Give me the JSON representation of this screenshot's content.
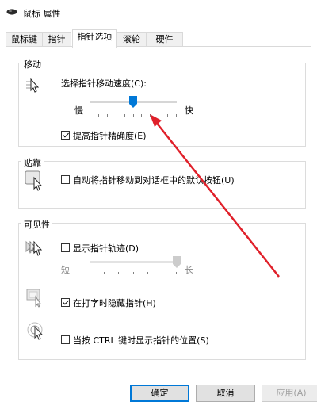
{
  "window": {
    "title": "鼠标 属性"
  },
  "tabs": [
    {
      "label": "鼠标键"
    },
    {
      "label": "指针"
    },
    {
      "label": "指针选项"
    },
    {
      "label": "滚轮"
    },
    {
      "label": "硬件"
    }
  ],
  "motion": {
    "group_label": "移动",
    "speed_label": "选择指针移动速度(C):",
    "slow_label": "慢",
    "fast_label": "快",
    "speed_level": 0.5,
    "precision_label": "提高指针精确度(E)",
    "precision_checked": true
  },
  "snap": {
    "group_label": "贴靠",
    "snap_label": "自动将指针移动到对话框中的默认按钮(U)",
    "snap_checked": false
  },
  "visibility": {
    "group_label": "可见性",
    "trails_label": "显示指针轨迹(D)",
    "trails_checked": false,
    "short_label": "短",
    "long_label": "长",
    "trail_level": 1.0,
    "hide_label": "在打字时隐藏指针(H)",
    "hide_checked": true,
    "ctrl_label": "当按 CTRL 键时显示指针的位置(S)",
    "ctrl_checked": false
  },
  "buttons": {
    "ok": "确定",
    "cancel": "取消",
    "apply": "应用(A)"
  },
  "colors": {
    "annotation_arrow": "#e0202a",
    "slider_thumb": "#0078d7",
    "tab_border": "#d9d9d9"
  }
}
